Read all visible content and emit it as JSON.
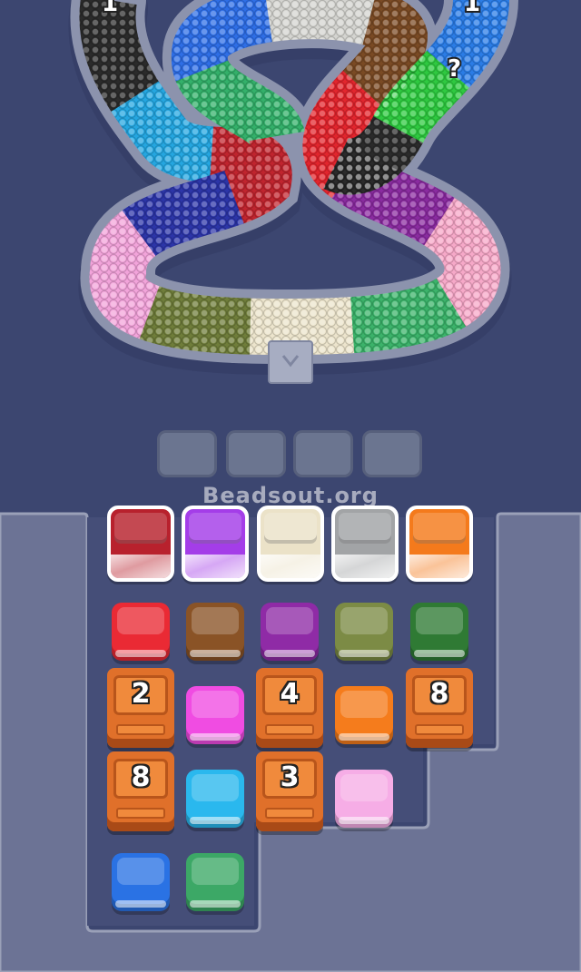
{
  "watermark": "Beadsout.org",
  "colors": {
    "background": "#3c4670",
    "board": "#6c7395",
    "well": "#454e78"
  },
  "track_mystery_marks": [
    "?"
  ],
  "top_counters": [
    "1",
    "1"
  ],
  "track_segments": [
    {
      "color": "#2b2b2b"
    },
    {
      "color": "#24a6e0"
    },
    {
      "color": "#c0242e"
    },
    {
      "color": "#2c35a8"
    },
    {
      "color": "#f2a3da"
    },
    {
      "color": "#6f7d3a"
    },
    {
      "color": "#ece4cc"
    },
    {
      "color": "#3bb36a"
    },
    {
      "color": "#f6a8c8"
    },
    {
      "color": "#8a2ba0"
    },
    {
      "color": "#e2252d"
    },
    {
      "color": "#7a4a24"
    },
    {
      "color": "#d4d4d0"
    },
    {
      "color": "#2e6ee6"
    },
    {
      "color": "#33b06a"
    },
    {
      "color": "#2a7ce6"
    },
    {
      "color": "#2ec940"
    },
    {
      "color": "#2b2b2b"
    }
  ],
  "buffer_slots": 4,
  "active_cups": [
    {
      "name": "dark-red",
      "color": "#b8212d"
    },
    {
      "name": "purple",
      "color": "#a43de8"
    },
    {
      "name": "cream",
      "color": "#ebe2c8"
    },
    {
      "name": "gray",
      "color": "#a2a4a6"
    },
    {
      "name": "orange",
      "color": "#f47a1c"
    }
  ],
  "grid_tiles": [
    {
      "name": "red",
      "color": "#ea2a34"
    },
    {
      "name": "brown",
      "color": "#8a5326"
    },
    {
      "name": "violet",
      "color": "#8f2ba6"
    },
    {
      "name": "olive",
      "color": "#7c8b45"
    },
    {
      "name": "green",
      "color": "#2f7a34"
    },
    {
      "name": "magenta",
      "color": "#f04ce2"
    },
    {
      "name": "orange",
      "color": "#f57c1c"
    },
    {
      "name": "cyan",
      "color": "#2ab8ee"
    },
    {
      "name": "pink",
      "color": "#f6ade6"
    },
    {
      "name": "blue",
      "color": "#2a72e4"
    },
    {
      "name": "green-teal",
      "color": "#3ca866"
    }
  ],
  "crates": [
    {
      "count": "2"
    },
    {
      "count": "4"
    },
    {
      "count": "8"
    },
    {
      "count": "8"
    },
    {
      "count": "3"
    }
  ]
}
